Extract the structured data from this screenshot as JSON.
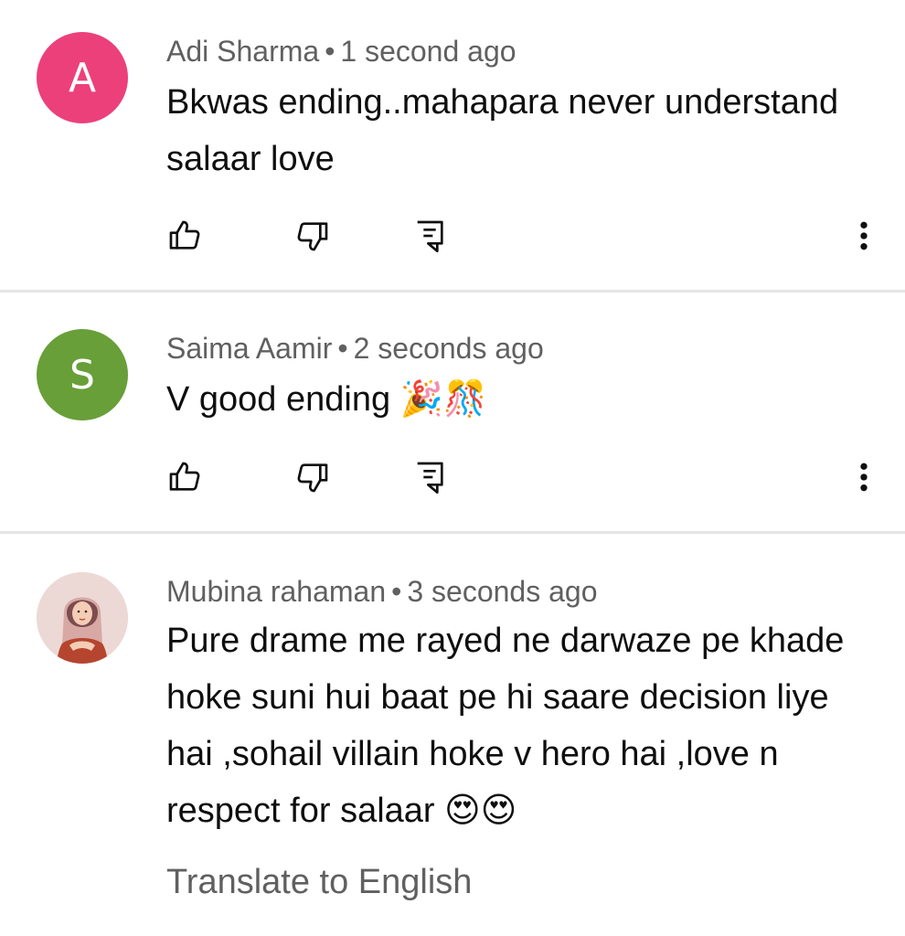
{
  "comments": [
    {
      "avatar_letter": "A",
      "avatar_color": "#ec407a",
      "author": "Adi Sharma",
      "separator": "•",
      "time": "1 second ago",
      "text": "Bkwas ending..mahapara never understand salaar love"
    },
    {
      "avatar_letter": "S",
      "avatar_color": "#689f38",
      "author": "Saima Aamir",
      "separator": "•",
      "time": "2 seconds ago",
      "text": "V good ending 🎉🎊"
    },
    {
      "avatar_letter": "",
      "avatar_color": "#e9d3d0",
      "author": "Mubina rahaman",
      "separator": "•",
      "time": "3 seconds ago",
      "text": "Pure drame me rayed ne darwaze pe khade hoke suni hui baat pe hi saare decision liye hai ,sohail villain hoke v hero hai ,love n respect for salaar 😍😍",
      "translate_label": "Translate to English"
    }
  ],
  "icons": {
    "like": "thumbs-up-icon",
    "dislike": "thumbs-down-icon",
    "reply": "reply-comment-icon",
    "more": "more-vertical-icon"
  },
  "colors": {
    "meta_text": "#606060",
    "divider": "#e5e5e5"
  }
}
